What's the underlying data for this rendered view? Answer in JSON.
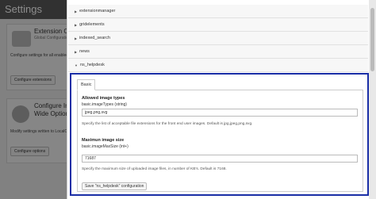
{
  "background": {
    "title": "Settings",
    "cards": [
      {
        "title": "Extension Configuration",
        "subtitle": "Global Configuration",
        "text": "Configure settings for all enabled extensions.",
        "button": "Configure extensions"
      },
      {
        "title": "Configure Installation-Wide Options",
        "subtitle": "",
        "text": "Modify settings written to LocalConfiguration.php.",
        "button": "Configure options"
      }
    ]
  },
  "extensions": [
    {
      "label": "extensionmanager",
      "expanded": false
    },
    {
      "label": "gridelements",
      "expanded": false
    },
    {
      "label": "indexed_search",
      "expanded": false
    },
    {
      "label": "news",
      "expanded": false
    },
    {
      "label": "ns_helpdesk",
      "expanded": true
    }
  ],
  "form": {
    "tab": "Basic",
    "fields": [
      {
        "title": "Allowed image types",
        "key": "basic.imageTypes (string)",
        "value": "jpeg,png,svg",
        "description": "Specify the list of acceptable file extensions for the front end user images. Default is jpg,jpeg,png,svg."
      },
      {
        "title": "Maximun image size",
        "key": "basic.imageMaxSize (int+)",
        "value": "71687",
        "description": "Specify the maximum size of uploaded image files, in number of KB's. Default is 7168."
      }
    ],
    "save_label": "Save \"ns_helpdesk\" configuration"
  },
  "colors": {
    "highlight_border": "#1a2ea6",
    "overlay": "rgba(0,0,0,0.45)"
  }
}
